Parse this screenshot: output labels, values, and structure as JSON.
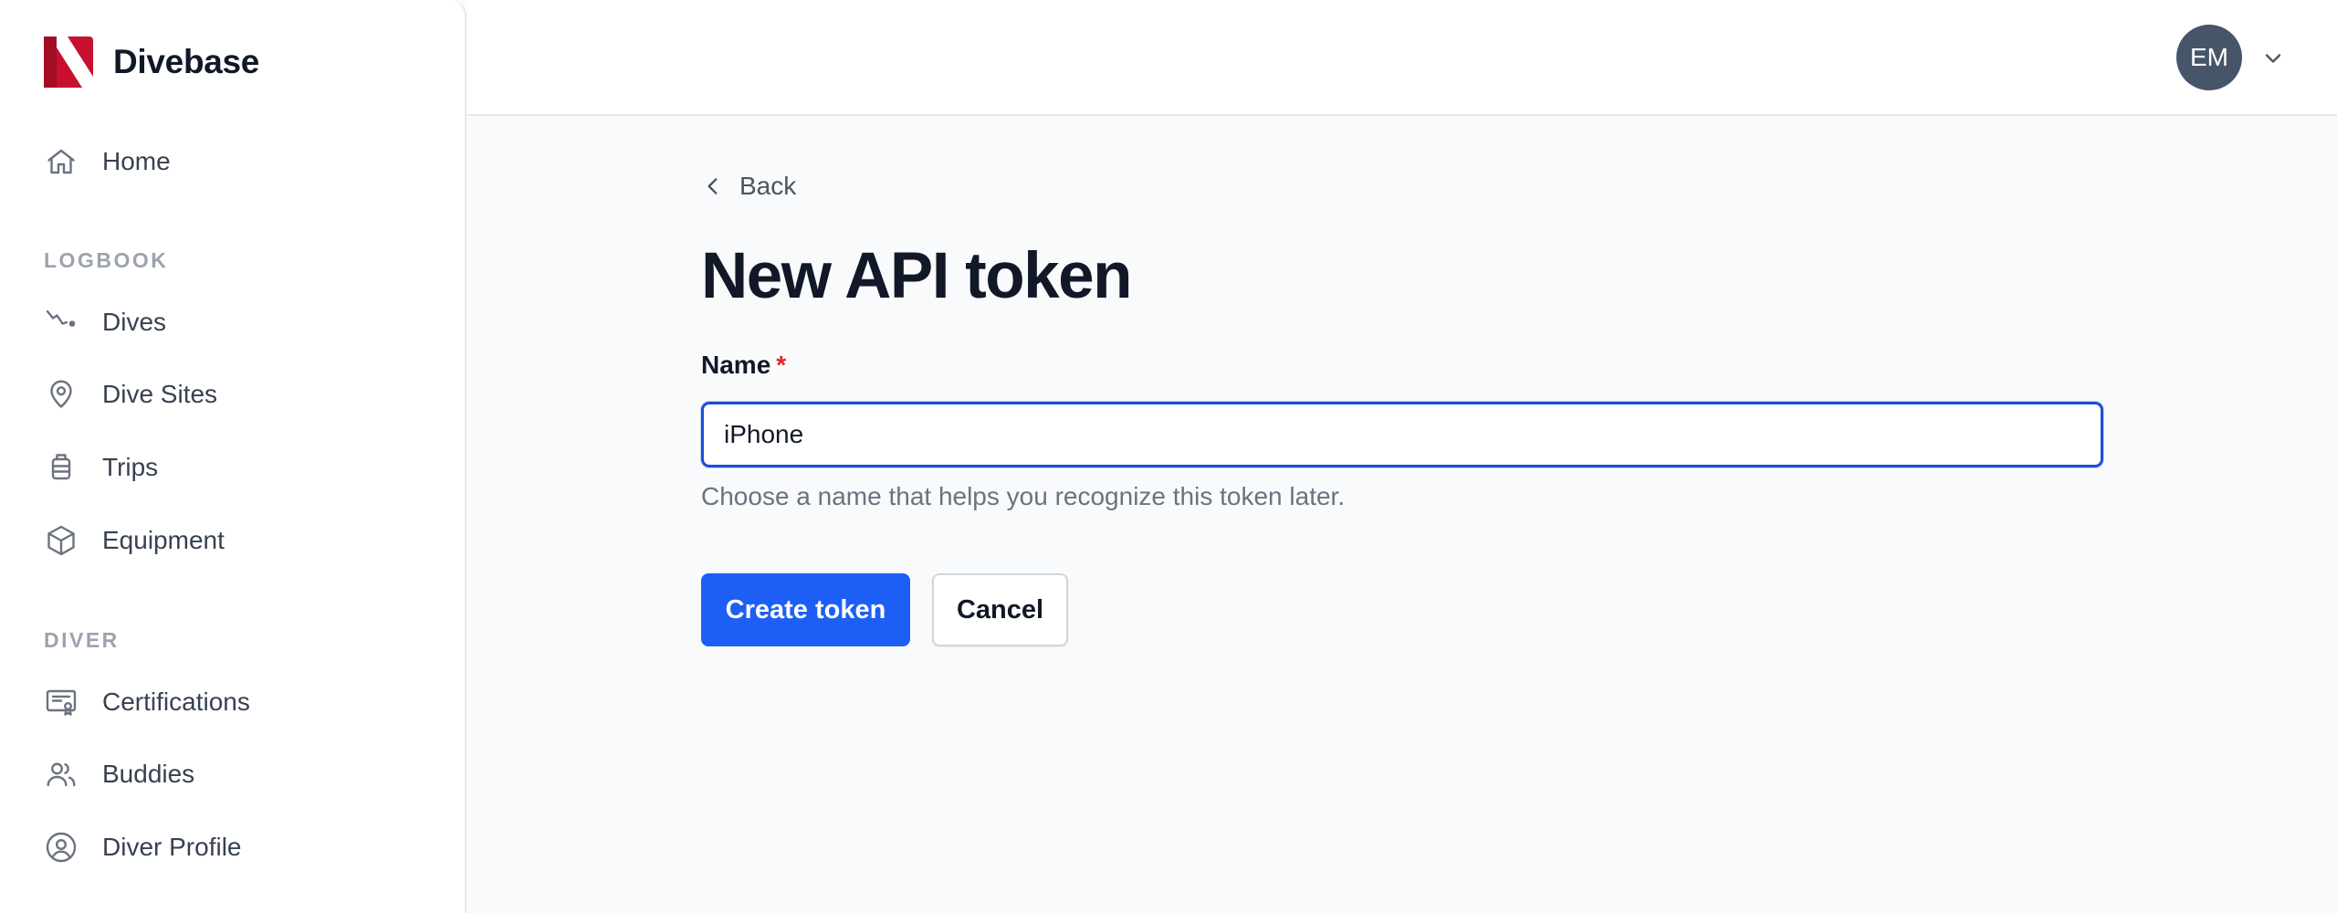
{
  "app": {
    "name": "Divebase"
  },
  "sidebar": {
    "home_label": "Home",
    "sections": [
      {
        "title": "LOGBOOK",
        "items": [
          {
            "label": "Dives",
            "icon": "dive-profile-icon"
          },
          {
            "label": "Dive Sites",
            "icon": "map-pin-icon"
          },
          {
            "label": "Trips",
            "icon": "luggage-icon"
          },
          {
            "label": "Equipment",
            "icon": "cube-icon"
          }
        ]
      },
      {
        "title": "DIVER",
        "items": [
          {
            "label": "Certifications",
            "icon": "certificate-icon"
          },
          {
            "label": "Buddies",
            "icon": "users-icon"
          },
          {
            "label": "Diver Profile",
            "icon": "user-circle-icon"
          }
        ]
      }
    ]
  },
  "header": {
    "avatar_initials": "EM"
  },
  "main": {
    "back_label": "Back",
    "title": "New API token",
    "name_field": {
      "label": "Name",
      "required_mark": "*",
      "value": "iPhone",
      "hint": "Choose a name that helps you recognize this token later."
    },
    "create_button": "Create token",
    "cancel_button": "Cancel"
  },
  "colors": {
    "primary": "#1d5ff5",
    "focus_ring": "#1d4ed8",
    "required": "#dc2626",
    "avatar_bg": "#475569",
    "brand_red": "#c8102e"
  }
}
